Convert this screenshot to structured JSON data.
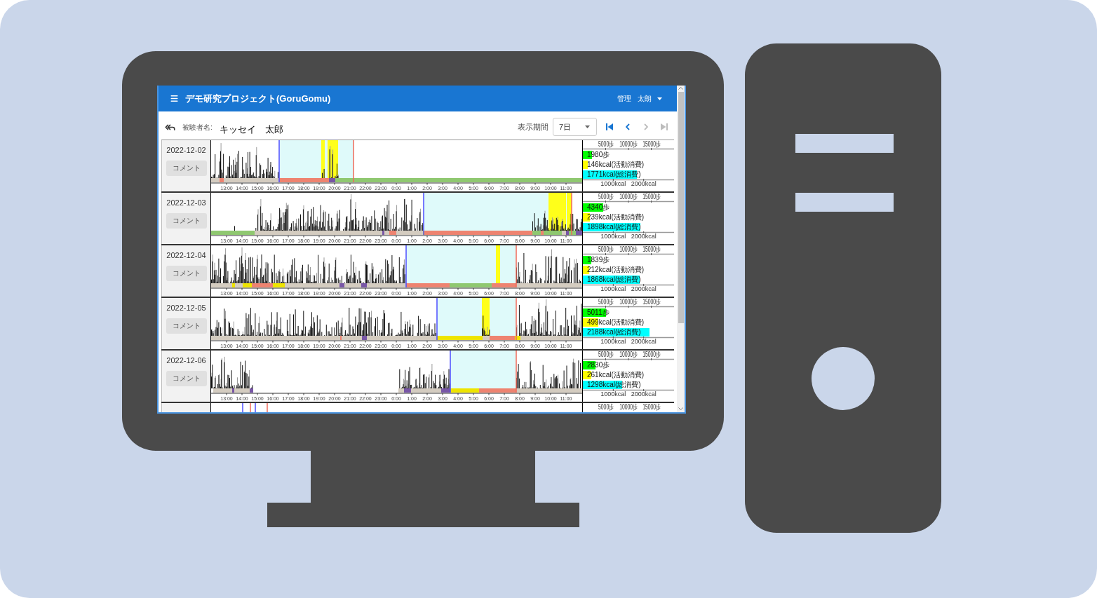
{
  "app_bar": {
    "title": "デモ研究プロジェクト(GoruGomu)",
    "admin_link": "管理",
    "user_name": "太朗"
  },
  "toolbar": {
    "subject_label": "被験者名:",
    "subject_name": "キッセイ　太郎",
    "period_label": "表示期間",
    "period_value": "7日",
    "nav_buttons": [
      {
        "kind": "first",
        "disabled": false
      },
      {
        "kind": "previous",
        "disabled": false
      },
      {
        "kind": "next",
        "disabled": true
      },
      {
        "kind": "last",
        "disabled": true
      }
    ]
  },
  "days": [
    {
      "date": "2022-12-02",
      "comment_button": "コメント",
      "time_axis": [
        "13:00",
        "14:00",
        "15:00",
        "16:00",
        "17:00",
        "18:00",
        "19:00",
        "20:00",
        "21:00",
        "22:00",
        "23:00",
        "0:00",
        "1:00",
        "2:00",
        "3:00",
        "4:00",
        "5:00",
        "6:00",
        "7:00",
        "8:00",
        "9:00",
        "10:00",
        "11:00"
      ],
      "summary": {
        "step_ticks": [
          "5000歩",
          "10000歩",
          "15000歩"
        ],
        "bars": [
          {
            "label": "1980歩",
            "level": 0.1,
            "color": "#00ff00"
          },
          {
            "label": "146kcal(活動消費)",
            "level": 0.05,
            "color": "#ffff00"
          },
          {
            "label": "1771kcal(総消費)",
            "level": 0.59,
            "color": "#00ffff"
          }
        ],
        "kcal_ticks": [
          "1000kcal",
          "2000kcal"
        ]
      }
    },
    {
      "date": "2022-12-03",
      "comment_button": "コメント",
      "time_axis": [
        "13:00",
        "14:00",
        "15:00",
        "16:00",
        "17:00",
        "18:00",
        "19:00",
        "20:00",
        "21:00",
        "22:00",
        "23:00",
        "0:00",
        "1:00",
        "2:00",
        "3:00",
        "4:00",
        "5:00",
        "6:00",
        "7:00",
        "8:00",
        "9:00",
        "10:00",
        "11:00"
      ],
      "summary": {
        "step_ticks": [
          "5000歩",
          "10000歩",
          "15000歩"
        ],
        "bars": [
          {
            "label": "4340歩",
            "level": 0.22,
            "color": "#00ff00"
          },
          {
            "label": "239kcal(活動消費)",
            "level": 0.08,
            "color": "#ffff00"
          },
          {
            "label": "1898kcal(総消費)",
            "level": 0.63,
            "color": "#00ffff"
          }
        ],
        "kcal_ticks": [
          "1000kcal",
          "2000kcal"
        ]
      }
    },
    {
      "date": "2022-12-04",
      "comment_button": "コメント",
      "time_axis": [
        "13:00",
        "14:00",
        "15:00",
        "16:00",
        "17:00",
        "18:00",
        "19:00",
        "20:00",
        "21:00",
        "22:00",
        "23:00",
        "0:00",
        "1:00",
        "2:00",
        "3:00",
        "4:00",
        "5:00",
        "6:00",
        "7:00",
        "8:00",
        "9:00",
        "10:00",
        "11:00"
      ],
      "summary": {
        "step_ticks": [
          "5000歩",
          "10000歩",
          "15000歩"
        ],
        "bars": [
          {
            "label": "1839歩",
            "level": 0.09,
            "color": "#00ff00"
          },
          {
            "label": "212kcal(活動消費)",
            "level": 0.07,
            "color": "#ffff00"
          },
          {
            "label": "1868kcal(総消費)",
            "level": 0.62,
            "color": "#00ffff"
          }
        ],
        "kcal_ticks": [
          "1000kcal",
          "2000kcal"
        ]
      }
    },
    {
      "date": "2022-12-05",
      "comment_button": "コメント",
      "time_axis": [
        "13:00",
        "14:00",
        "15:00",
        "16:00",
        "17:00",
        "18:00",
        "19:00",
        "20:00",
        "21:00",
        "22:00",
        "23:00",
        "0:00",
        "1:00",
        "2:00",
        "3:00",
        "4:00",
        "5:00",
        "6:00",
        "7:00",
        "8:00",
        "9:00",
        "10:00",
        "11:00"
      ],
      "summary": {
        "step_ticks": [
          "5000歩",
          "10000歩",
          "15000歩"
        ],
        "bars": [
          {
            "label": "5011歩",
            "level": 0.25,
            "color": "#00ff00"
          },
          {
            "label": "499kcal(活動消費)",
            "level": 0.17,
            "color": "#ffff00"
          },
          {
            "label": "2188kcal(総消費)",
            "level": 0.73,
            "color": "#00ffff"
          }
        ],
        "kcal_ticks": [
          "1000kcal",
          "2000kcal"
        ]
      }
    },
    {
      "date": "2022-12-06",
      "comment_button": "コメント",
      "time_axis": [
        "13:00",
        "14:00",
        "15:00",
        "16:00",
        "17:00",
        "18:00",
        "19:00",
        "20:00",
        "21:00",
        "22:00",
        "23:00",
        "0:00",
        "1:00",
        "2:00",
        "3:00",
        "4:00",
        "5:00",
        "6:00",
        "7:00",
        "8:00",
        "9:00",
        "10:00",
        "11:00"
      ],
      "summary": {
        "step_ticks": [
          "5000歩",
          "10000歩",
          "15000歩"
        ],
        "bars": [
          {
            "label": "2830歩",
            "level": 0.14,
            "color": "#00ff00"
          },
          {
            "label": "261kcal(活動消費)",
            "level": 0.09,
            "color": "#ffff00"
          },
          {
            "label": "1298kcal(総消費)",
            "level": 0.43,
            "color": "#00ffff"
          }
        ],
        "kcal_ticks": [
          "1000kcal",
          "2000kcal"
        ]
      }
    }
  ],
  "next_day_partial": {
    "step_ticks": [
      "5000歩",
      "10000歩",
      "15000歩"
    ]
  }
}
